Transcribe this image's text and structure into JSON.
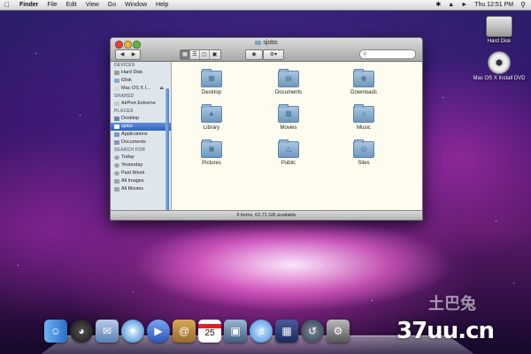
{
  "menubar": {
    "menus": [
      "Finder",
      "File",
      "Edit",
      "View",
      "Go",
      "Window",
      "Help"
    ],
    "clock": "Thu 12:51 PM"
  },
  "desktop_icons": [
    {
      "label": "Hard Disk"
    },
    {
      "label": "Mac OS X Install DVD"
    }
  ],
  "window": {
    "title": "sjobs",
    "status": "9 items, 62.71 GB available",
    "sidebar": {
      "sections": [
        {
          "header": "DEVICES",
          "items": [
            "Hard Disk",
            "iDisk",
            "Mac OS X I..."
          ]
        },
        {
          "header": "SHARED",
          "items": [
            "AirPort Extreme"
          ]
        },
        {
          "header": "PLACES",
          "items": [
            "Desktop",
            "sjobs",
            "Applications",
            "Documents"
          ]
        },
        {
          "header": "SEARCH FOR",
          "items": [
            "Today",
            "Yesterday",
            "Past Week",
            "All Images",
            "All Movies"
          ]
        }
      ],
      "selected": "sjobs"
    },
    "folders": [
      {
        "label": "Desktop",
        "icon": "desktop-folder-icon"
      },
      {
        "label": "Documents",
        "icon": "documents-folder-icon"
      },
      {
        "label": "Downloads",
        "icon": "downloads-folder-icon"
      },
      {
        "label": "Library",
        "icon": "library-folder-icon"
      },
      {
        "label": "Movies",
        "icon": "movies-folder-icon"
      },
      {
        "label": "Music",
        "icon": "music-folder-icon"
      },
      {
        "label": "Pictures",
        "icon": "pictures-folder-icon"
      },
      {
        "label": "Public",
        "icon": "public-folder-icon"
      },
      {
        "label": "Sites",
        "icon": "sites-folder-icon"
      }
    ]
  },
  "dock": {
    "apps": [
      {
        "name": "finder-icon",
        "color": "#3a7bd5"
      },
      {
        "name": "dashboard-icon",
        "color": "#333333"
      },
      {
        "name": "mail-icon",
        "color": "#6a8fc0"
      },
      {
        "name": "safari-icon",
        "color": "#2f80d1"
      },
      {
        "name": "ichat-icon",
        "color": "#3f6fd8"
      },
      {
        "name": "address-book-icon",
        "color": "#b0873a"
      },
      {
        "name": "ical-icon",
        "color": "#ffffff"
      },
      {
        "name": "iphoto-icon",
        "color": "#4a6a8a"
      },
      {
        "name": "itunes-icon",
        "color": "#4aa0e0"
      },
      {
        "name": "spaces-icon",
        "color": "#2a3a6a"
      },
      {
        "name": "time-machine-icon",
        "color": "#3a4a5a"
      },
      {
        "name": "system-preferences-icon",
        "color": "#7a7a7a"
      }
    ],
    "ical_day": "25"
  },
  "watermark": {
    "text": "37uu.cn",
    "cn": "土巴兔"
  }
}
